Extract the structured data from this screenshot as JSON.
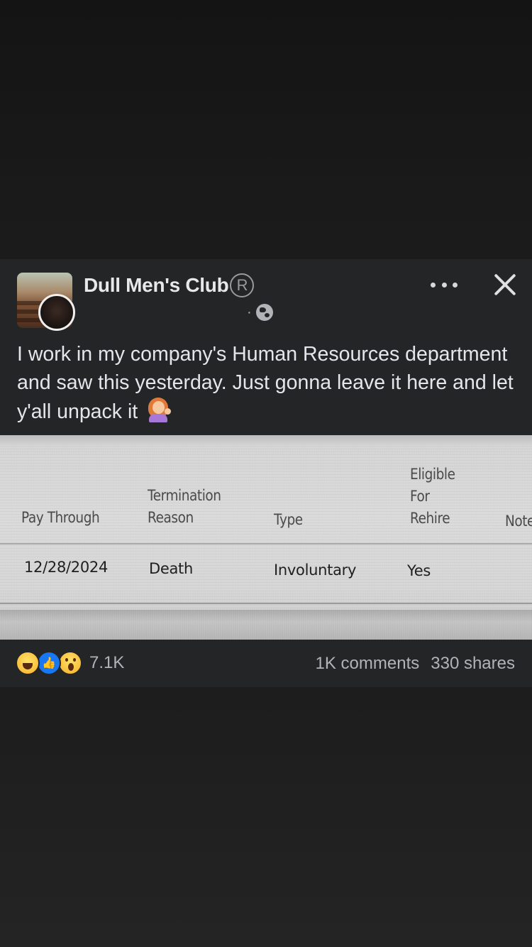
{
  "post": {
    "page_name": "Dull Men's Club",
    "registered_mark": "R",
    "meta_dot": "·",
    "text": "I work in my company's Human Resources department and saw this yesterday. Just gonna leave it here and let y'all unpack it"
  },
  "table_photo": {
    "headers": {
      "pay_through": "Pay Through",
      "termination_reason": "Termination\nReason",
      "type": "Type",
      "eligible_for_rehire": "Eligible\nFor\nRehire",
      "notes": "Note"
    },
    "row": {
      "pay_through": "12/28/2024",
      "termination_reason": "Death",
      "type": "Involuntary",
      "eligible_for_rehire": "Yes"
    }
  },
  "footer": {
    "reaction_count": "7.1K",
    "comments": "1K comments",
    "shares": "330 shares"
  },
  "icons": [
    "haha-reaction-icon",
    "like-reaction-icon",
    "wow-reaction-icon",
    "globe-icon",
    "more-icon",
    "close-icon"
  ],
  "colors": {
    "card_bg": "#242526",
    "text_primary": "#e4e6eb",
    "text_secondary": "#b0b3b8",
    "like_blue": "#1877f2"
  }
}
